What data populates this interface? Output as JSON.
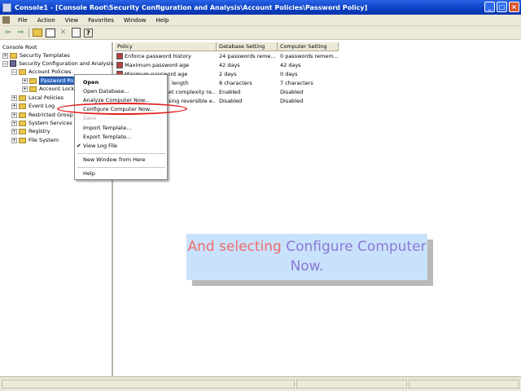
{
  "window": {
    "title": "Console1 - [Console Root\\Security Configuration and Analysis\\Account Policies\\Password Policy]",
    "buttons": [
      "_",
      "□",
      "×"
    ]
  },
  "menubar": {
    "items": [
      "File",
      "Action",
      "View",
      "Favorites",
      "Window",
      "Help"
    ]
  },
  "toolbar": {
    "icons": [
      "back-icon",
      "forward-icon",
      "up-folder-icon",
      "show-hide-tree-icon",
      "delete-icon",
      "properties-icon",
      "help-icon"
    ],
    "glyphs": {
      "back": "⇦",
      "forward": "⇨",
      "delete": "✕",
      "help": "?"
    }
  },
  "tree": {
    "root": "Console Root",
    "security_templates": "Security Templates",
    "sca": "Security Configuration and Analysis",
    "account_policies": "Account Policies",
    "password_policy": "Password Po",
    "account_lockout": "Account Lock",
    "local_policies": "Local Policies",
    "event_log": "Event Log",
    "restricted_groups": "Restricted Group",
    "system_services": "System Services",
    "registry": "Registry",
    "file_system": "File System"
  },
  "table": {
    "columns": [
      "Policy",
      "Database Setting",
      "Computer Setting"
    ],
    "rows": [
      {
        "policy": "Enforce password history",
        "db": "24 passwords reme...",
        "computer": "0 passwords remem..."
      },
      {
        "policy": "Maximum password age",
        "db": "42 days",
        "computer": "42 days"
      },
      {
        "policy": "Minimum password age",
        "db": "2 days",
        "computer": "0 days"
      },
      {
        "policy": "length",
        "db": "8 characters",
        "computer": "7 characters"
      },
      {
        "policy": "et complexity re...",
        "db": "Enabled",
        "computer": "Disabled"
      },
      {
        "policy": "sing reversible e...",
        "db": "Disabled",
        "computer": "Disabled"
      }
    ]
  },
  "context_menu": {
    "open": "Open",
    "open_database": "Open Database...",
    "analyze": "Analyze Computer Now...",
    "configure": "Configure Computer Now...",
    "save": "Save",
    "import": "Import Template...",
    "export": "Export Template...",
    "view_log": "View Log File",
    "view_log_check": "✔",
    "new_window": "New Window from Here",
    "help": "Help"
  },
  "callout": {
    "part1": "And selecting ",
    "part2": "Configure Computer Now."
  },
  "colors": {
    "highlight_ellipse": "#e02020",
    "callout_bg": "#c9e2fb",
    "callout_text": "#8a79d6",
    "callout_highlight": "#ee6b6b"
  }
}
